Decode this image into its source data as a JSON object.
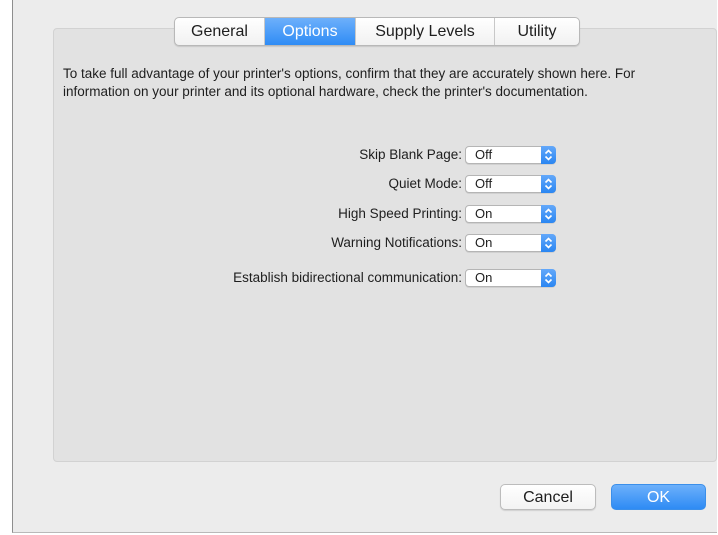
{
  "tabs": [
    {
      "label": "General",
      "active": false
    },
    {
      "label": "Options",
      "active": true
    },
    {
      "label": "Supply Levels",
      "active": false
    },
    {
      "label": "Utility",
      "active": false
    }
  ],
  "description": "To take full advantage of your printer's options, confirm that they are accurately shown here. For information on your printer and its optional hardware, check the printer's documentation.",
  "options": [
    {
      "label": "Skip Blank Page:",
      "value": "Off"
    },
    {
      "label": "Quiet Mode:",
      "value": "Off"
    },
    {
      "label": "High Speed Printing:",
      "value": "On"
    },
    {
      "label": "Warning Notifications:",
      "value": "On"
    },
    {
      "label": "Establish bidirectional communication:",
      "value": "On"
    }
  ],
  "buttons": {
    "cancel_label": "Cancel",
    "ok_label": "OK"
  },
  "colors": {
    "accent": "#2f8cf5",
    "window_bg": "#ececec",
    "panel_bg": "#e2e2e2"
  },
  "icons": {
    "popup_stepper": "chevron-up-down-icon"
  }
}
